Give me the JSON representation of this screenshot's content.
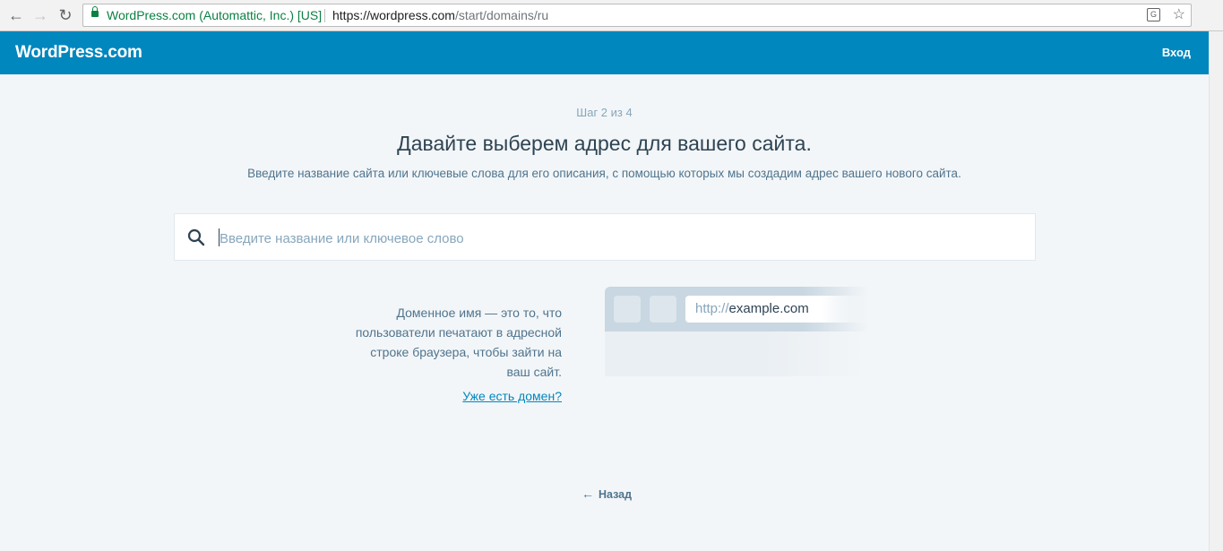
{
  "browser": {
    "back_icon": "arrow-left-icon",
    "forward_icon": "arrow-right-icon",
    "reload_icon": "reload-icon",
    "ev_label": "WordPress.com (Automattic, Inc.) [US]",
    "url_base": "https://wordpress.com",
    "url_path": "/start/domains/ru"
  },
  "header": {
    "logo": "WordPress.com",
    "login": "Вход",
    "color": "#0087be"
  },
  "main": {
    "step": "Шаг 2 из 4",
    "headline": "Давайте выберем адрес для вашего сайта.",
    "subhead": "Введите название сайта или ключевые слова для его описания, с помощью которых мы создадим адрес вашего нового сайта.",
    "search": {
      "placeholder": "Введите название или ключевое слово",
      "value": ""
    },
    "explain_lines": [
      "Доменное имя — это то, что",
      "пользователи печатают в адресной",
      "строке браузера, чтобы зайти на",
      "ваш сайт."
    ],
    "have_domain": "Уже есть домен?",
    "illustration": {
      "protocol": "http://",
      "domain": "example.com"
    },
    "back": "Назад"
  }
}
